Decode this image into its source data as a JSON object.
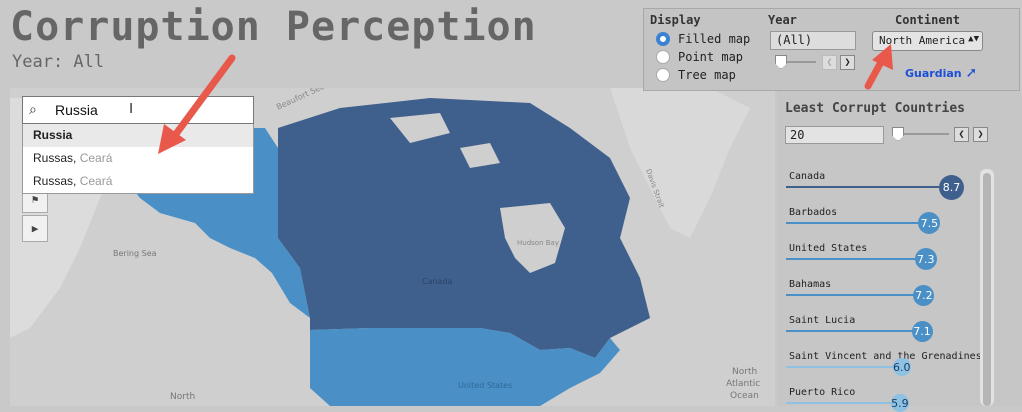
{
  "title": "Corruption Perception",
  "subtitle": "Year: All",
  "controls": {
    "display_label": "Display",
    "year_label": "Year",
    "continent_label": "Continent",
    "display_options": [
      {
        "label": "Filled map",
        "selected": true
      },
      {
        "label": "Point map",
        "selected": false
      },
      {
        "label": "Tree map",
        "selected": false
      }
    ],
    "year_value": "(All)",
    "continent_value": "North America",
    "guardian_link": "Guardian"
  },
  "search": {
    "value": "Russia",
    "results": [
      {
        "name": "Russia",
        "detail": ""
      },
      {
        "name": "Russas,",
        "detail": "Ceará"
      },
      {
        "name": "Russas,",
        "detail": "Ceará"
      }
    ]
  },
  "map_labels": {
    "beaufort": "Beaufort Sea",
    "bering": "Bering Sea",
    "hudson": "Hudson Bay",
    "canada": "Canada",
    "united": "United States",
    "davis": "Davis Strait",
    "north": "North",
    "atlantic1": "North",
    "atlantic2": "Atlantic",
    "atlantic3": "Ocean"
  },
  "ranking": {
    "title": "Least Corrupt Countries",
    "count": "20",
    "items": [
      {
        "name": "Canada",
        "value": "8.7"
      },
      {
        "name": "Barbados",
        "value": "7.5"
      },
      {
        "name": "United States",
        "value": "7.3"
      },
      {
        "name": "Bahamas",
        "value": "7.2"
      },
      {
        "name": "Saint Lucia",
        "value": "7.1"
      },
      {
        "name": "Saint Vincent and the Grenadines",
        "value": "6.0"
      },
      {
        "name": "Puerto Rico",
        "value": "5.9"
      }
    ]
  },
  "colors": {
    "dark_blue": "#3f5f8c",
    "mid_blue": "#4a8fc6",
    "light_blue": "#8fc1e3",
    "accent": "#3b82d4",
    "arrow": "#e8584b"
  }
}
